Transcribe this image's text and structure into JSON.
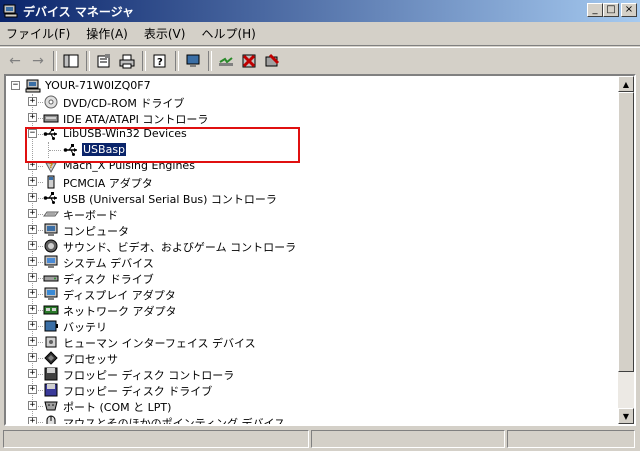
{
  "window": {
    "title": "デバイス マネージャ"
  },
  "window_buttons": {
    "minimize": "_",
    "maximize": "□",
    "close": "×"
  },
  "menu": [
    "ファイル(F)",
    "操作(A)",
    "表示(V)",
    "ヘルプ(H)"
  ],
  "toolbar": {
    "back": "←",
    "forward": "→"
  },
  "tree": {
    "root": "YOUR-71W0IZQ0F7",
    "items": [
      {
        "label": "DVD/CD-ROM ドライブ",
        "icon": "cdrom-icon"
      },
      {
        "label": "IDE ATA/ATAPI コントローラ",
        "icon": "ide-controller-icon"
      },
      {
        "label": "LibUSB-Win32 Devices",
        "icon": "usb-icon",
        "expanded": true,
        "children": [
          {
            "label": "USBasp",
            "icon": "usb-icon",
            "selected": true
          }
        ]
      },
      {
        "label": "Mach_X Pulsing Engines",
        "icon": "device-icon"
      },
      {
        "label": "PCMCIA アダプタ",
        "icon": "pcmcia-icon"
      },
      {
        "label": "USB (Universal Serial Bus) コントローラ",
        "icon": "usb-icon"
      },
      {
        "label": "キーボード",
        "icon": "keyboard-icon"
      },
      {
        "label": "コンピュータ",
        "icon": "computer-icon"
      },
      {
        "label": "サウンド、ビデオ、およびゲーム コントローラ",
        "icon": "sound-icon"
      },
      {
        "label": "システム デバイス",
        "icon": "system-icon"
      },
      {
        "label": "ディスク ドライブ",
        "icon": "disk-icon"
      },
      {
        "label": "ディスプレイ アダプタ",
        "icon": "display-icon"
      },
      {
        "label": "ネットワーク アダプタ",
        "icon": "network-icon"
      },
      {
        "label": "バッテリ",
        "icon": "battery-icon"
      },
      {
        "label": "ヒューマン インターフェイス デバイス",
        "icon": "hid-icon"
      },
      {
        "label": "プロセッサ",
        "icon": "processor-icon"
      },
      {
        "label": "フロッピー ディスク コントローラ",
        "icon": "floppy-controller-icon"
      },
      {
        "label": "フロッピー ディスク ドライブ",
        "icon": "floppy-icon"
      },
      {
        "label": "ポート (COM と LPT)",
        "icon": "port-icon"
      },
      {
        "label": "マウスとそのほかのポインティング デバイス",
        "icon": "mouse-icon"
      }
    ]
  },
  "colors": {
    "highlight_box": "#e01010",
    "selection": "#0a246a",
    "title_start": "#0a246a",
    "title_end": "#a6caf0"
  }
}
